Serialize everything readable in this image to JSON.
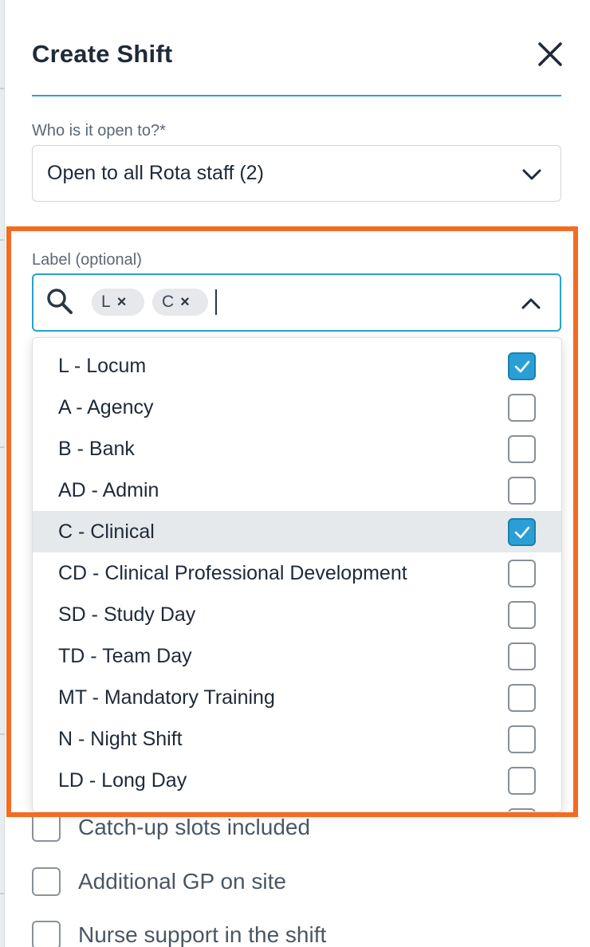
{
  "modal": {
    "title": "Create Shift",
    "close_icon": "close-icon"
  },
  "open_to": {
    "label": "Who is it open to?*",
    "value": "Open to all Rota staff (2)",
    "icon": "chevron-down-icon"
  },
  "label_field": {
    "label": "Label (optional)",
    "icon": "search-icon",
    "chips": [
      {
        "text": "L",
        "remove": "×"
      },
      {
        "text": "C",
        "remove": "×"
      }
    ],
    "toggle_icon": "chevron-up-icon",
    "options": [
      {
        "label": "L - Locum",
        "checked": true
      },
      {
        "label": "A - Agency",
        "checked": false
      },
      {
        "label": "B - Bank",
        "checked": false
      },
      {
        "label": "AD - Admin",
        "checked": false
      },
      {
        "label": "C - Clinical",
        "checked": true
      },
      {
        "label": "CD - Clinical Professional Development",
        "checked": false
      },
      {
        "label": "SD - Study Day",
        "checked": false
      },
      {
        "label": "TD - Team Day",
        "checked": false
      },
      {
        "label": "MT - Mandatory Training",
        "checked": false
      },
      {
        "label": "N - Night Shift",
        "checked": false
      },
      {
        "label": "LD - Long Day",
        "checked": false
      }
    ]
  },
  "extra_options": [
    {
      "label": "Catch-up slots included",
      "checked": false
    },
    {
      "label": "Additional GP on site",
      "checked": false
    },
    {
      "label": "Nurse support in the shift",
      "checked": false
    }
  ],
  "colors": {
    "accent": "#26a3cc",
    "checkbox_checked": "#2a9fd6",
    "highlight_border": "#f36c21"
  }
}
